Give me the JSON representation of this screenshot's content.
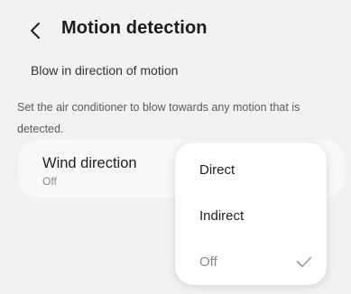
{
  "header": {
    "back_icon": "chevron-left-icon",
    "title": "Motion detection"
  },
  "section": {
    "label": "Blow in direction of motion",
    "description": "Set the air conditioner to blow towards any motion that is detected."
  },
  "wind_direction": {
    "title": "Wind direction",
    "value": "Off"
  },
  "dropdown": {
    "options": [
      {
        "label": "Direct"
      },
      {
        "label": "Indirect"
      },
      {
        "label": "Off",
        "selected": true
      }
    ],
    "check_icon": "check-icon"
  },
  "colors": {
    "background": "#f2f2f2",
    "card": "#f8f8f8",
    "popup": "#ffffff",
    "muted_text": "#8a8a8a",
    "text": "#1f1f1f"
  }
}
